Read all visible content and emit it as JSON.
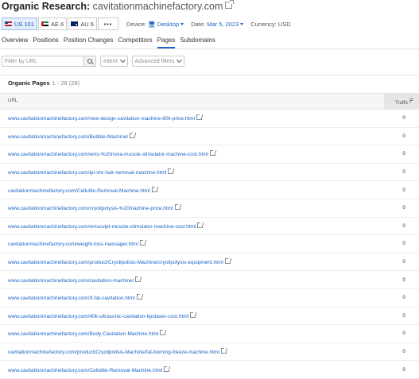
{
  "header": {
    "title": "Organic Research:",
    "domain": "cavitationmachinefactory.com"
  },
  "databases": [
    {
      "label": "US 101",
      "flag": "us",
      "active": true
    },
    {
      "label": "AE 6",
      "flag": "ae",
      "active": false
    },
    {
      "label": "AU 6",
      "flag": "au",
      "active": false
    }
  ],
  "more_label": "•••",
  "meta": {
    "device_label": "Device:",
    "device_value": "Desktop",
    "date_label": "Date:",
    "date_value": "Mar 5, 2023",
    "currency_label": "Currency:",
    "currency_value": "USD"
  },
  "tabs": [
    "Overview",
    "Positions",
    "Position Changes",
    "Competitors",
    "Pages",
    "Subdomains"
  ],
  "active_tab": "Pages",
  "filters": {
    "url_placeholder": "Filter by URL",
    "intent_label": "Intent",
    "advanced_label": "Advanced filters"
  },
  "table": {
    "title": "Organic Pages",
    "range": "1 - 28 (28)",
    "col_url": "URL",
    "col_traffic": "Traffic",
    "rows": [
      {
        "url": "www.cavitationmachinefactory.com/new-design-cavitation-machine-80k-price.html",
        "traffic": "0"
      },
      {
        "url": "www.cavitationmachinefactory.com/Bubble-Machine/",
        "traffic": "0"
      },
      {
        "url": "www.cavitationmachinefactory.com/ems-%20nova-muscle-stimulator-machine-cost.html",
        "traffic": "0"
      },
      {
        "url": "www.cavitationmachinefactory.com/ipl-shr-hair-removal-machine.html",
        "traffic": "0"
      },
      {
        "url": "cavitationmachinefactory.com/Cellulite-Removal-Machine.html",
        "traffic": "0"
      },
      {
        "url": "www.cavitationmachinefactory.com/cryolipolysis-%20machine-price.html",
        "traffic": "0"
      },
      {
        "url": "www.cavitationmachinefactory.com/emsculpt-muscle-stimulator-machine-cost.html",
        "traffic": "0"
      },
      {
        "url": "cavitationmachinefactory.com/weight-loss-massager.html",
        "traffic": "0"
      },
      {
        "url": "www.cavitationmachinefactory.com/product/Cryolipolisis-Machine/cryolipolysis-equipment.html",
        "traffic": "0"
      },
      {
        "url": "www.cavitationmachinefactory.com/cavitation-machine/",
        "traffic": "0"
      },
      {
        "url": "www.cavitationmachinefactory.com/rf-fat-cavitation.html",
        "traffic": "0"
      },
      {
        "url": "www.cavitationmachinefactory.com/40k-ultrasonic-cavitation-lipolaser-cost.html",
        "traffic": "0"
      },
      {
        "url": "www.cavitationmachinefactory.com/Body-Cavitation-Machine.html",
        "traffic": "0"
      },
      {
        "url": "cavitationmachinefactory.com/product/Cryolipolisis-Machine/fat-burning-freeze-machine.html",
        "traffic": "0"
      },
      {
        "url": "www.cavitationmachinefactory.com/Cellulite-Removal-Machine.html",
        "traffic": "0"
      }
    ]
  }
}
